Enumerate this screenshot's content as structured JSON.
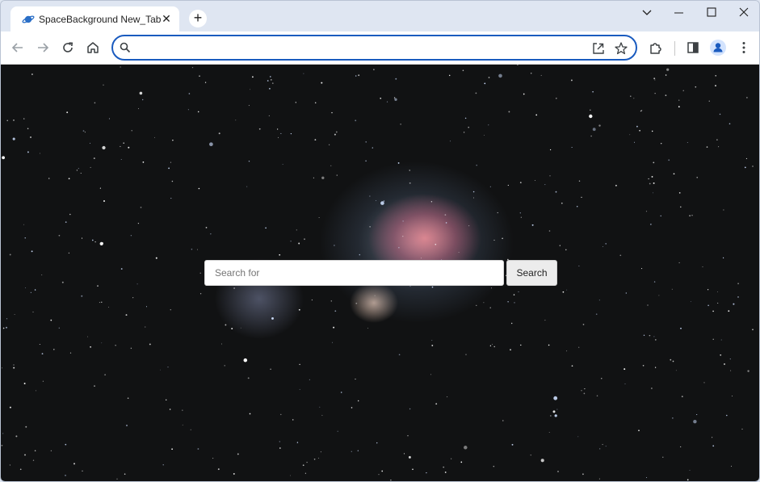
{
  "browser": {
    "tab": {
      "title": "SpaceBackground New_Tab",
      "favicon": "planet-icon",
      "close_glyph": "✕"
    },
    "new_tab_glyph": "+",
    "window_controls": [
      "chevron-down-icon",
      "minimize-icon",
      "maximize-icon",
      "close-icon"
    ],
    "toolbar": {
      "nav_icons": [
        "back-arrow-icon",
        "forward-arrow-icon",
        "reload-icon",
        "home-icon"
      ],
      "omnibox": {
        "value": "",
        "placeholder": ""
      },
      "omnibox_icons": [
        "search-icon",
        "share-icon",
        "star-icon"
      ],
      "right_icons": [
        "extensions-icon",
        "side-panel-icon",
        "profile-avatar-icon",
        "kebab-menu-icon"
      ]
    },
    "accent_color": "#1a5bbf",
    "frame_color": "#dfe6f2"
  },
  "page": {
    "background": "orion-nebula-starfield",
    "search": {
      "placeholder": "Search for",
      "value": "",
      "button_label": "Search"
    }
  }
}
